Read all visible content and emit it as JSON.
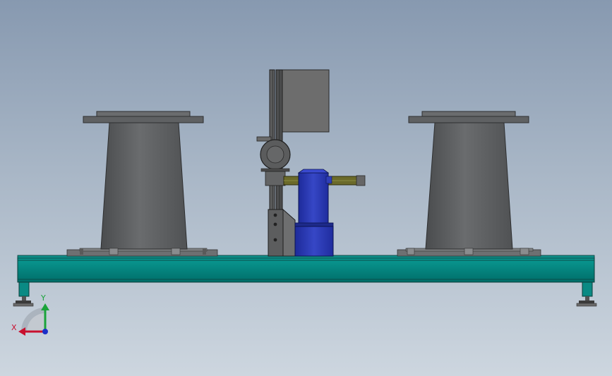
{
  "viewport": {
    "background_top": "#8799b0",
    "background_bottom": "#cdd6df"
  },
  "triad": {
    "x_label": "X",
    "y_label": "Y",
    "x_color": "#c8102e",
    "y_color": "#1aa33a",
    "z_color": "#1a2fc8"
  },
  "model": {
    "base_color": "#00807a",
    "pedestal_color": "#5c5e60",
    "motor_color": "#2b3cb0",
    "arm_color": "#6b6a2a",
    "panel_color": "#6d6d6d"
  }
}
